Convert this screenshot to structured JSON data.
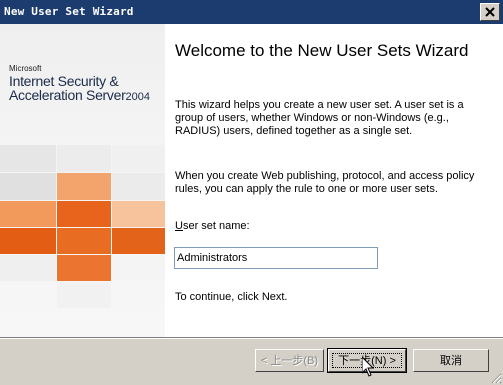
{
  "window": {
    "title": "New User Set Wizard",
    "close_glyph": "x"
  },
  "branding": {
    "company": "Microsoft",
    "product_line1": "Internet Security &",
    "product_line2": "Acceleration Server",
    "product_year": "2004"
  },
  "wizard": {
    "heading": "Welcome to the New User Sets Wizard",
    "description": "This wizard helps you create a new user set. A user set is a group of users, whether Windows or non-Windows (e.g., RADIUS) users, defined together as a single set.",
    "rules_note": "When you create Web publishing, protocol, and access policy rules, you can apply the rule to one or more user sets.",
    "field_label_mnemonic": "U",
    "field_label_rest": "ser set name:",
    "field_value": "Administrators",
    "continue_text": "To continue, click Next."
  },
  "buttons": {
    "back": "< 上一步(B)",
    "next": "下一步(N) >",
    "cancel": "取消"
  },
  "icons": {
    "close": "close-icon",
    "cursor": "mouse-pointer-icon",
    "grip": "resize-grip-icon"
  },
  "colors": {
    "titlebar": "#1c3b6e",
    "accent_orange_dark": "#e05a10",
    "accent_orange_light": "#f4a46a",
    "face": "#d4d0c8"
  }
}
